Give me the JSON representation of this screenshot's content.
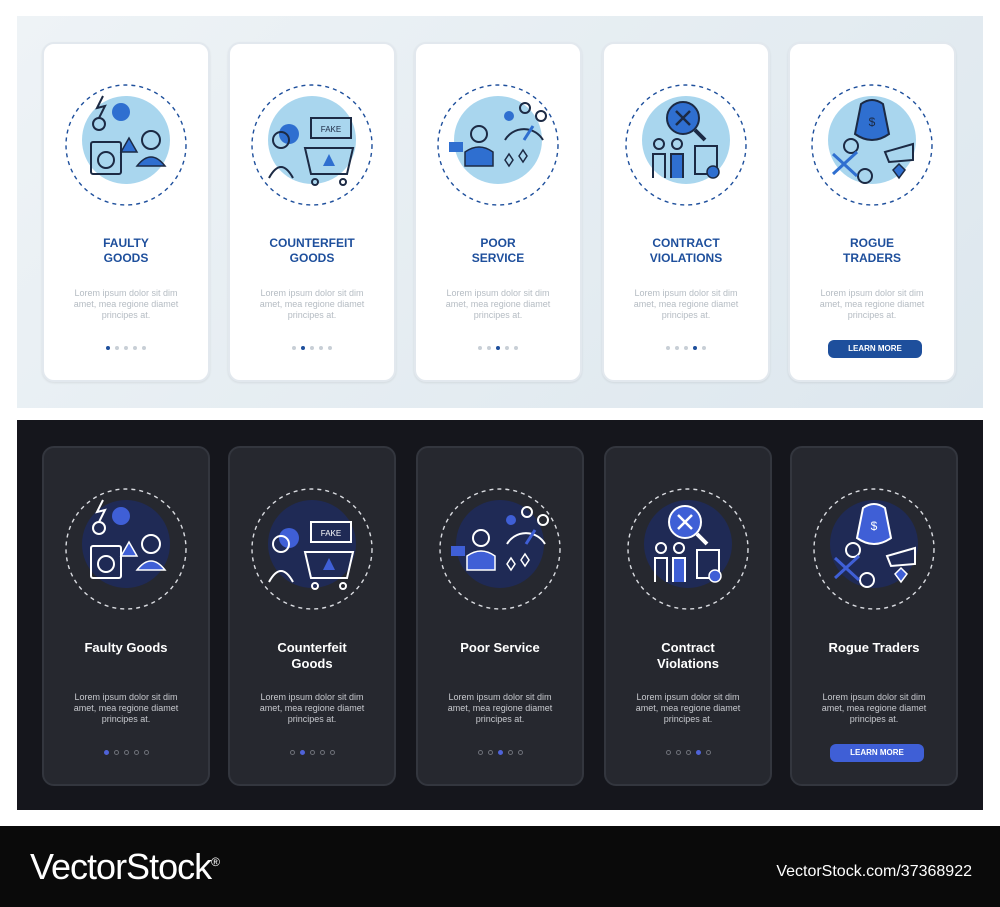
{
  "light_cards": [
    {
      "title_lines": [
        "Faulty",
        "Goods"
      ],
      "desc_lines": [
        "Lorem ipsum dolor sit dim",
        "amet, mea regione diamet",
        "principes at."
      ],
      "icon": "faulty-goods-icon",
      "active": 0
    },
    {
      "title_lines": [
        "Counterfeit",
        "Goods"
      ],
      "desc_lines": [
        "Lorem ipsum dolor sit dim",
        "amet, mea regione diamet",
        "principes at."
      ],
      "icon": "counterfeit-goods-icon",
      "active": 1
    },
    {
      "title_lines": [
        "Poor",
        "Service"
      ],
      "desc_lines": [
        "Lorem ipsum dolor sit dim",
        "amet, mea regione diamet",
        "principes at."
      ],
      "icon": "poor-service-icon",
      "active": 2
    },
    {
      "title_lines": [
        "Contract",
        "Violations"
      ],
      "desc_lines": [
        "Lorem ipsum dolor sit dim",
        "amet, mea regione diamet",
        "principes at."
      ],
      "icon": "contract-violations-icon",
      "active": 3
    },
    {
      "title_lines": [
        "Rogue",
        "Traders"
      ],
      "desc_lines": [
        "Lorem ipsum dolor sit dim",
        "amet, mea regione diamet",
        "principes at."
      ],
      "icon": "rogue-traders-icon",
      "cta": "LEARN MORE"
    }
  ],
  "dark_cards": [
    {
      "title_lines": [
        "Faulty Goods",
        ""
      ],
      "desc_lines": [
        "Lorem ipsum dolor sit dim",
        "amet, mea regione diamet",
        "principes at."
      ],
      "icon": "faulty-goods-icon",
      "active": 0
    },
    {
      "title_lines": [
        "Counterfeit",
        "Goods"
      ],
      "desc_lines": [
        "Lorem ipsum dolor sit dim",
        "amet, mea regione diamet",
        "principes at."
      ],
      "icon": "counterfeit-goods-icon",
      "active": 1
    },
    {
      "title_lines": [
        "Poor Service",
        ""
      ],
      "desc_lines": [
        "Lorem ipsum dolor sit dim",
        "amet, mea regione diamet",
        "principes at."
      ],
      "icon": "poor-service-icon",
      "active": 2
    },
    {
      "title_lines": [
        "Contract",
        "Violations"
      ],
      "desc_lines": [
        "Lorem ipsum dolor sit dim",
        "amet, mea regione diamet",
        "principes at."
      ],
      "icon": "contract-violations-icon",
      "active": 3
    },
    {
      "title_lines": [
        "Rogue Traders",
        ""
      ],
      "desc_lines": [
        "Lorem ipsum dolor sit dim",
        "amet, mea regione diamet",
        "principes at."
      ],
      "icon": "rogue-traders-icon",
      "cta": "LEARN MORE"
    }
  ],
  "dots_count": 5,
  "footer": {
    "brand": "VectorStock",
    "reg": "®",
    "url": "VectorStock.com/37368922"
  },
  "colors": {
    "light_accent": "#1e4f9c",
    "light_circle": "#a9d6ee",
    "dark_accent": "#3f5fd6",
    "dark_circle": "#1f2a55"
  }
}
